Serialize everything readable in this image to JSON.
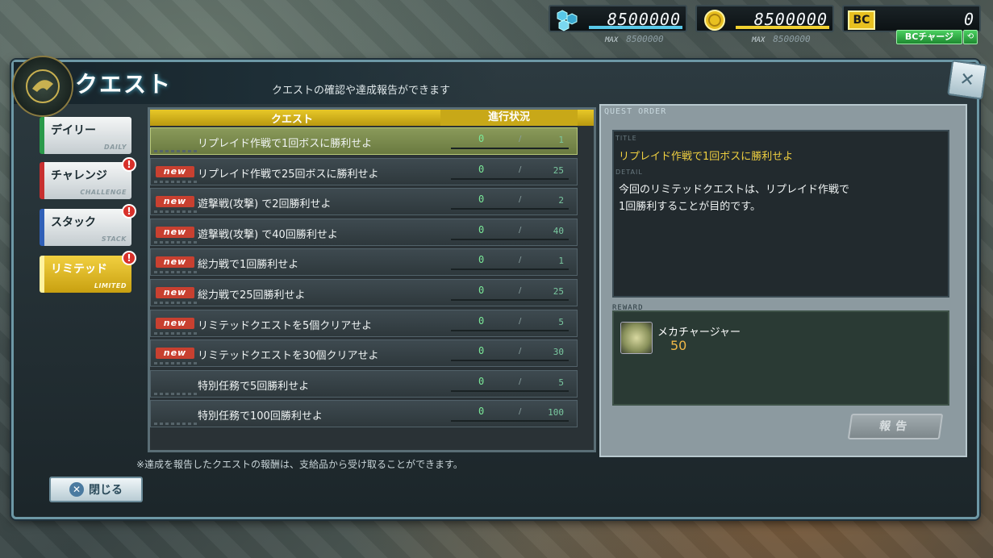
{
  "resources": {
    "crystal": {
      "value": "8500000",
      "max_label": "MAX",
      "max_value": "8500000",
      "color": "#58c8e8"
    },
    "coin": {
      "value": "8500000",
      "max_label": "MAX",
      "max_value": "8500000",
      "color": "#f0d030"
    },
    "bc": {
      "label": "BC",
      "value": "0",
      "charge_label": "BCチャージ",
      "swap_icon": "⟲"
    }
  },
  "window": {
    "title": "クエスト",
    "subtitle": "クエストの確認や達成報告ができます",
    "close_icon": "✕"
  },
  "tabs": [
    {
      "label": "デイリー",
      "sub": "DAILY",
      "color": "#2a9a4a",
      "badge": ""
    },
    {
      "label": "チャレンジ",
      "sub": "CHALLENGE",
      "color": "#c83030",
      "badge": "!"
    },
    {
      "label": "スタック",
      "sub": "STACK",
      "color": "#3060b8",
      "badge": "!"
    },
    {
      "label": "リミテッド",
      "sub": "LIMITED",
      "color": "#f0d040",
      "badge": "!",
      "active": true
    }
  ],
  "list": {
    "header_quest": "クエスト",
    "header_progress": "進行状況",
    "rows": [
      {
        "new": false,
        "name": "リプレイド作戦で1回ボスに勝利せよ",
        "current": "0",
        "total": "1",
        "selected": true
      },
      {
        "new": true,
        "name": "リプレイド作戦で25回ボスに勝利せよ",
        "current": "0",
        "total": "25"
      },
      {
        "new": true,
        "name": "遊撃戦(攻撃) で2回勝利せよ",
        "current": "0",
        "total": "2"
      },
      {
        "new": true,
        "name": "遊撃戦(攻撃) で40回勝利せよ",
        "current": "0",
        "total": "40"
      },
      {
        "new": true,
        "name": "総力戦で1回勝利せよ",
        "current": "0",
        "total": "1"
      },
      {
        "new": true,
        "name": "総力戦で25回勝利せよ",
        "current": "0",
        "total": "25"
      },
      {
        "new": true,
        "name": "リミテッドクエストを5個クリアせよ",
        "current": "0",
        "total": "5"
      },
      {
        "new": true,
        "name": "リミテッドクエストを30個クリアせよ",
        "current": "0",
        "total": "30"
      },
      {
        "new": false,
        "name": "特別任務で5回勝利せよ",
        "current": "0",
        "total": "5"
      },
      {
        "new": false,
        "name": "特別任務で100回勝利せよ",
        "current": "0",
        "total": "100"
      }
    ],
    "new_label": "new",
    "slash": "/"
  },
  "footnote": "※達成を報告したクエストの報酬は、支給品から受け取ることができます。",
  "detail": {
    "section_label": "QUEST ORDER",
    "title_label": "TITLE",
    "title": "リプレイド作戦で1回ボスに勝利せよ",
    "detail_label": "DETAIL",
    "body_line1": "今回のリミテッドクエストは、リプレイド作戦で",
    "body_line2": "1回勝利することが目的です。",
    "reward_label": "REWARD",
    "reward_name": "メカチャージャー",
    "reward_count": "50",
    "report_label": "報告"
  },
  "close_button": {
    "label": "閉じる",
    "icon": "✕"
  }
}
